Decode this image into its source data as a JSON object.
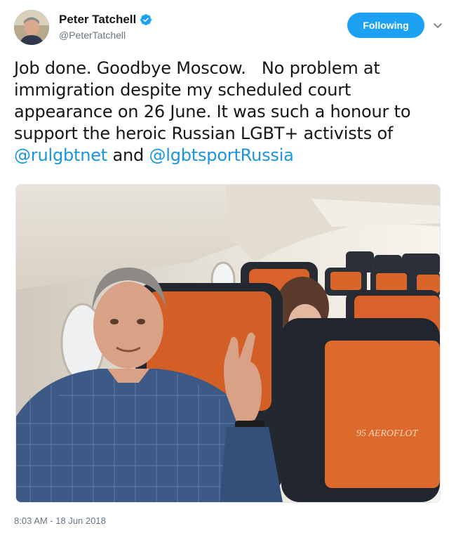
{
  "author": {
    "display_name": "Peter Tatchell",
    "handle": "@PeterTatchell",
    "verified_icon": "verified-badge-icon"
  },
  "follow_button": {
    "label": "Following"
  },
  "menu_icon": "chevron-down-icon",
  "tweet": {
    "text_part1": "Job done. Goodbye Moscow.   No problem at immigration despite my scheduled court appearance on 26 June. It was such a honour to support the heroic Russian LGBT+ activists of ",
    "mention1": "@rulgbtnet",
    "text_part2": " and ",
    "mention2": "@lgbtsportRussia"
  },
  "photo_caption_logo": "95 AEROFLOT",
  "timestamp": "8:03 AM - 18 Jun 2018",
  "colors": {
    "accent": "#1da1f2",
    "link": "#1b95e0",
    "secondary_text": "#657786",
    "seat_orange": "#e06a2b"
  }
}
